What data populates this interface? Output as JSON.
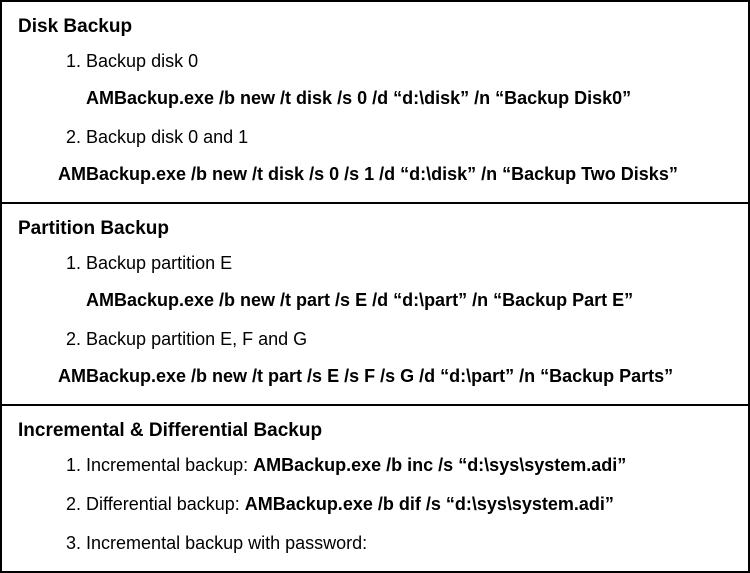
{
  "sections": [
    {
      "title": "Disk Backup",
      "items": [
        {
          "num": "1.",
          "label": "Backup disk 0",
          "cmd": "AMBackup.exe /b new /t disk /s 0 /d “d:\\disk” /n “Backup Disk0”",
          "cmd_wide": false
        },
        {
          "num": "2.",
          "label": "Backup disk 0 and 1",
          "cmd": "AMBackup.exe /b new /t disk /s 0 /s 1 /d “d:\\disk” /n “Backup Two Disks”",
          "cmd_wide": true
        }
      ]
    },
    {
      "title": "Partition Backup",
      "items": [
        {
          "num": "1.",
          "label": "Backup partition E",
          "cmd": "AMBackup.exe /b new /t part /s E /d “d:\\part” /n “Backup Part E”",
          "cmd_wide": false
        },
        {
          "num": "2.",
          "label": "Backup partition E, F and G",
          "cmd": "AMBackup.exe /b new /t part /s E /s F /s G /d “d:\\part” /n “Backup Parts”",
          "cmd_wide": true
        }
      ]
    },
    {
      "title": "Incremental & Differential Backup",
      "items": [
        {
          "num": "1.",
          "label": "Incremental backup: ",
          "cmd_inline": "AMBackup.exe /b inc /s “d:\\sys\\system.adi”"
        },
        {
          "num": "2.",
          "label": "Differential backup: ",
          "cmd_inline": "AMBackup.exe /b dif /s “d:\\sys\\system.adi”"
        },
        {
          "num": "3.",
          "label": "Incremental backup with password:",
          "cmd_inline": ""
        }
      ]
    }
  ]
}
